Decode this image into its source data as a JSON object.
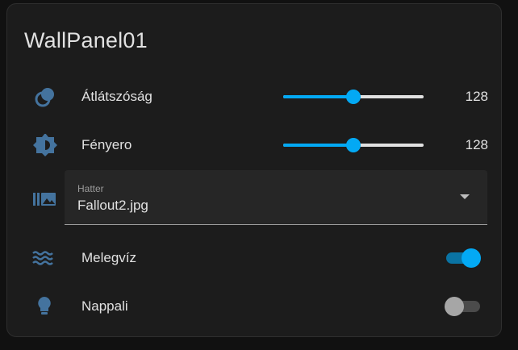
{
  "card": {
    "title": "WallPanel01",
    "accent_color": "#03a9f4",
    "icon_color": "#44739e"
  },
  "rows": {
    "opacity": {
      "icon": "opacity-circles-icon",
      "label": "Átlátszóság",
      "value": "128",
      "level": 0.5
    },
    "brightness": {
      "icon": "brightness-icon",
      "label": "Fényero",
      "value": "128",
      "level": 0.5
    },
    "background": {
      "icon": "image-gallery-icon",
      "field_label": "Hatter",
      "selected": "Fallout2.jpg"
    },
    "hot_water": {
      "icon": "water-waves-icon",
      "label": "Melegvíz",
      "state": "on"
    },
    "living_room": {
      "icon": "lightbulb-icon",
      "label": "Nappali",
      "state": "off"
    }
  }
}
